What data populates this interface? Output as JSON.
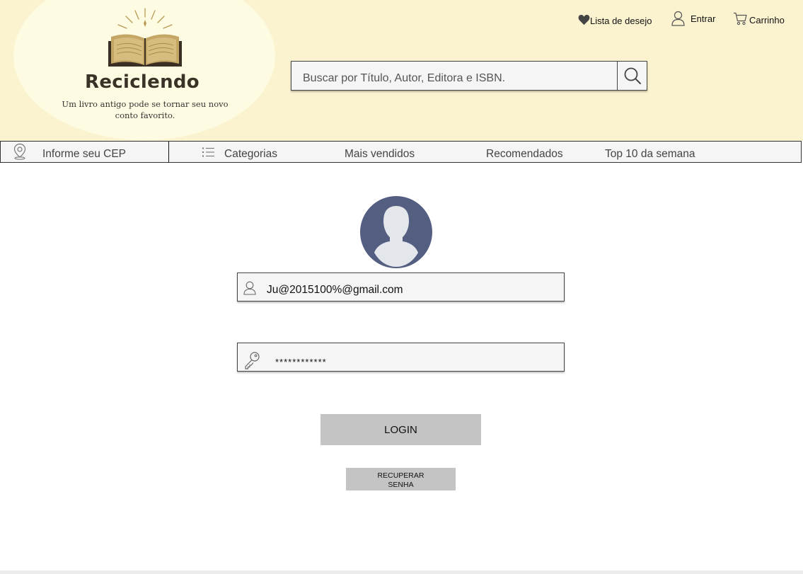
{
  "brand": {
    "name": "Reciclendo",
    "tagline": "Um livro antigo pode se tornar seu novo conto favorito."
  },
  "header": {
    "wishlist_label": "Lista de desejo",
    "login_label": "Entrar",
    "cart_label": "Carrinho"
  },
  "search": {
    "placeholder": "Buscar por Título, Autor, Editora e ISBN."
  },
  "nav": {
    "cep_label": "Informe seu CEP",
    "categories_label": "Categorias",
    "best_sellers_label": "Mais vendidos",
    "recommended_label": "Recomendados",
    "top10_label": "Top 10 da semana"
  },
  "login": {
    "email_value": "Ju@2015100%@gmail.com",
    "password_value": "************",
    "login_button": "LOGIN",
    "recover_button": "RECUPERAR SENHA"
  },
  "colors": {
    "header_bg": "#fbf3cf",
    "logo_bg": "#fefbe3",
    "avatar_bg": "#535e80",
    "button_bg": "#c4c4c4"
  }
}
